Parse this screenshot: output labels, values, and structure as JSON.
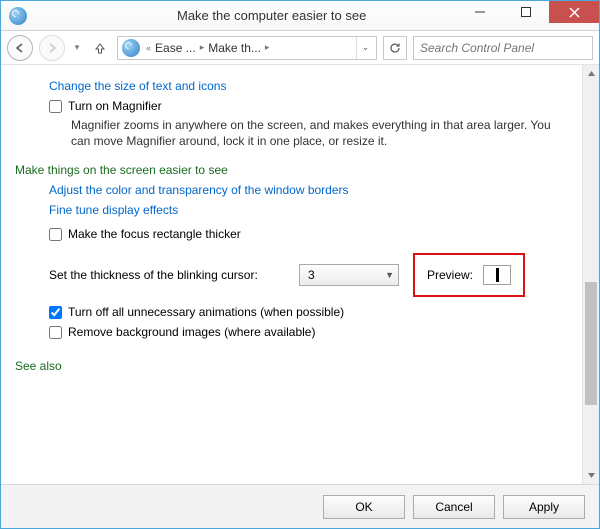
{
  "window": {
    "title": "Make the computer easier to see"
  },
  "nav": {
    "overflow_marker": "«",
    "crumb1": "Ease ...",
    "crumb2": "Make th...",
    "search_placeholder": "Search Control Panel"
  },
  "content": {
    "link_change_size": "Change the size of text and icons",
    "magnifier": {
      "label": "Turn on Magnifier",
      "desc": "Magnifier zooms in anywhere on the screen, and makes everything in that area larger. You can move Magnifier around, lock it in one place, or resize it."
    },
    "section2_head": "Make things on the screen easier to see",
    "link_adjust_color": "Adjust the color and transparency of the window borders",
    "link_fine_tune": "Fine tune display effects",
    "focus_rect_label": "Make the focus rectangle thicker",
    "cursor_thickness_label": "Set the thickness of the blinking cursor:",
    "cursor_thickness_value": "3",
    "preview_label": "Preview:",
    "turn_off_anim_label": "Turn off all unnecessary animations (when possible)",
    "remove_bg_label": "Remove background images (where available)",
    "see_also_head": "See also"
  },
  "footer": {
    "ok": "OK",
    "cancel": "Cancel",
    "apply": "Apply"
  }
}
